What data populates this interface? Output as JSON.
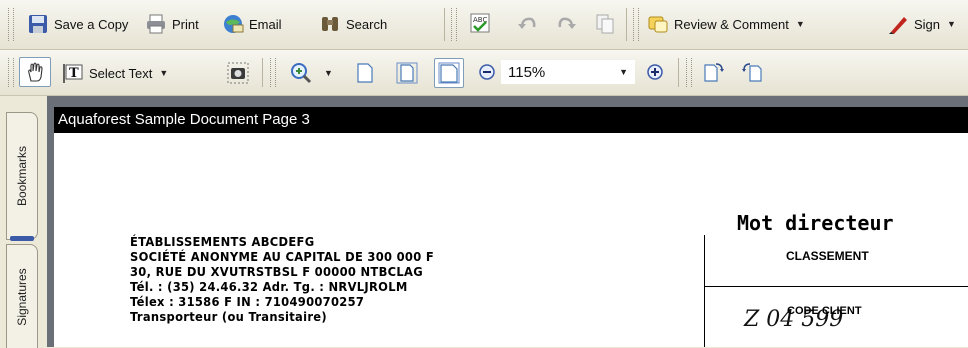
{
  "toolbar_top": {
    "save_copy": "Save a Copy",
    "print": "Print",
    "email": "Email",
    "search": "Search",
    "review": "Review & Comment",
    "sign": "Sign"
  },
  "toolbar_bottom": {
    "select_text": "Select Text",
    "zoom": "115%"
  },
  "sidebar": {
    "bookmarks": "Bookmarks",
    "signatures": "Signatures"
  },
  "document": {
    "title": "Aquaforest Sample Document Page 3",
    "address_lines": [
      "ÉTABLISSEMENTS ABCDEFG",
      "SOCIÉTÉ ANONYME AU CAPITAL DE 300 000 F",
      "30, RUE DU XVUTRSTBSL F 00000 NTBCLAG",
      "Tél. : (35) 24.46.32 Adr. Tg. : NRVLJROLM",
      "Télex : 31586 F IN : 710490070257",
      "Transporteur (ou Transitaire)"
    ],
    "mot_directeur": "Mot directeur",
    "classement": "CLASSEMENT",
    "code_client": "CODE CLIENT",
    "handwritten": "Z 04 599"
  },
  "colors": {
    "toolbar_bg": "#ece9d8",
    "doc_title_bg": "#000000",
    "frame": "#6b7078"
  }
}
